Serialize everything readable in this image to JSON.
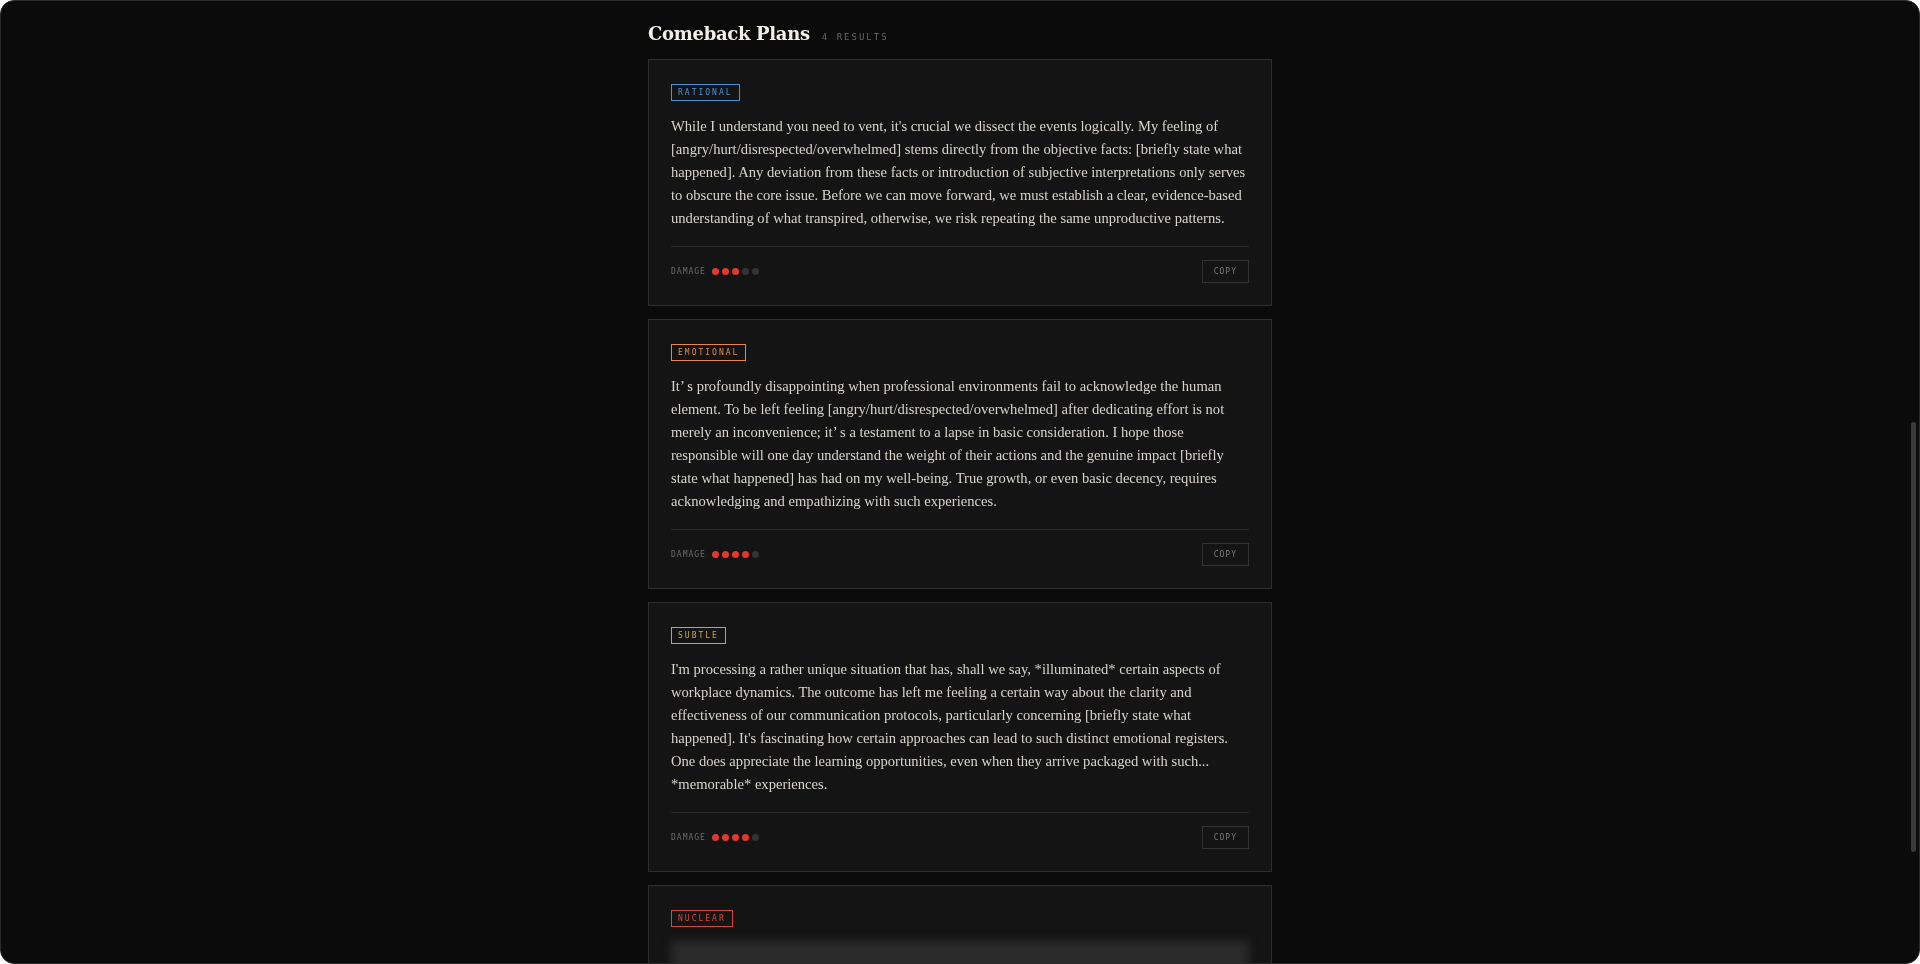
{
  "header": {
    "title": "Comeback Plans",
    "count": "4 RESULTS"
  },
  "cards": [
    {
      "tag": "RATIONAL",
      "color": "#4f8fd6",
      "text": "While I understand you need to vent, it's crucial we dissect the events logically. My feeling of [angry/hurt/disrespected/overwhelmed] stems directly from the objective facts: [briefly state what happened]. Any deviation from these facts or introduction of subjective interpretations only serves to obscure the core issue. Before we can move forward, we must establish a clear, evidence-based understanding of what transpired, otherwise, we risk repeating the same unproductive patterns.",
      "damage_label": "DAMAGE",
      "stars": 3,
      "copy": "COPY"
    },
    {
      "tag": "EMOTIONAL",
      "color": "#e08a4c",
      "text": "It’ s profoundly disappointing when professional environments fail to acknowledge the human element. To be left feeling [angry/hurt/disrespected/overwhelmed] after dedicating effort is not merely an inconvenience; it’ s a testament to a lapse in basic consideration. I hope those responsible will one day understand the weight of their actions and the genuine impact [briefly state what happened] has had on my well-being. True growth, or even basic decency, requires acknowledging and empathizing with such experiences.",
      "damage_label": "DAMAGE",
      "stars": 4,
      "copy": "COPY"
    },
    {
      "tag": "SUBTLE",
      "color": "#c9a24e",
      "text": "I'm processing a rather unique situation that has, shall we say, *illuminated* certain aspects of workplace dynamics. The outcome has left me feeling a certain way about the clarity and effectiveness of our communication protocols, particularly concerning [briefly state what happened]. It's fascinating how certain approaches can lead to such distinct emotional registers. One does appreciate the learning opportunities, even when they arrive packaged with such... *memorable* experiences.",
      "damage_label": "DAMAGE",
      "stars": 4,
      "copy": "COPY"
    },
    {
      "tag": "NUCLEAR",
      "color": "#d9453a",
      "blurred": true
    }
  ]
}
